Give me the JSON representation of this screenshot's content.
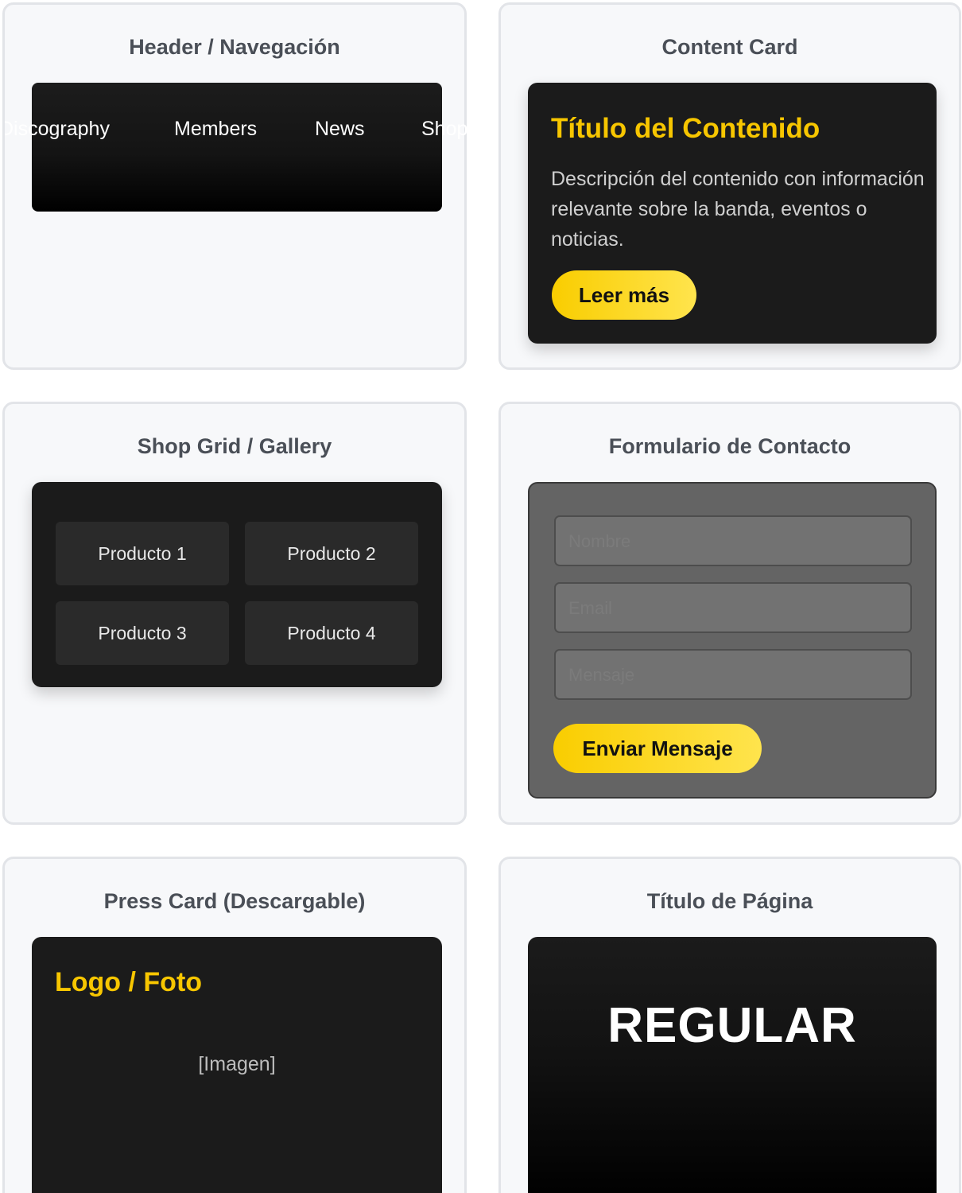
{
  "panels": {
    "header": {
      "title": "Header / Navegación",
      "nav": [
        "Discography",
        "Members",
        "News",
        "Shop"
      ]
    },
    "content": {
      "title": "Content Card",
      "card_title": "Título del Contenido",
      "card_desc": "Descripción del contenido con información relevante sobre la banda, eventos o noticias.",
      "button": "Leer más"
    },
    "shop": {
      "title": "Shop Grid / Gallery",
      "products": [
        "Producto 1",
        "Producto 2",
        "Producto 3",
        "Producto 4"
      ]
    },
    "form": {
      "title": "Formulario de Contacto",
      "fields": [
        "Nombre",
        "Email",
        "Mensaje"
      ],
      "button": "Enviar Mensaje"
    },
    "press": {
      "title": "Press Card (Descargable)",
      "card_title": "Logo / Foto",
      "image_placeholder": "[Imagen]"
    },
    "page_title": {
      "title": "Título de Página",
      "banner": "REGULAR"
    }
  },
  "colors": {
    "accent": "#f7c600",
    "card": "#1b1b1b",
    "panel": "#f7f8fa"
  }
}
